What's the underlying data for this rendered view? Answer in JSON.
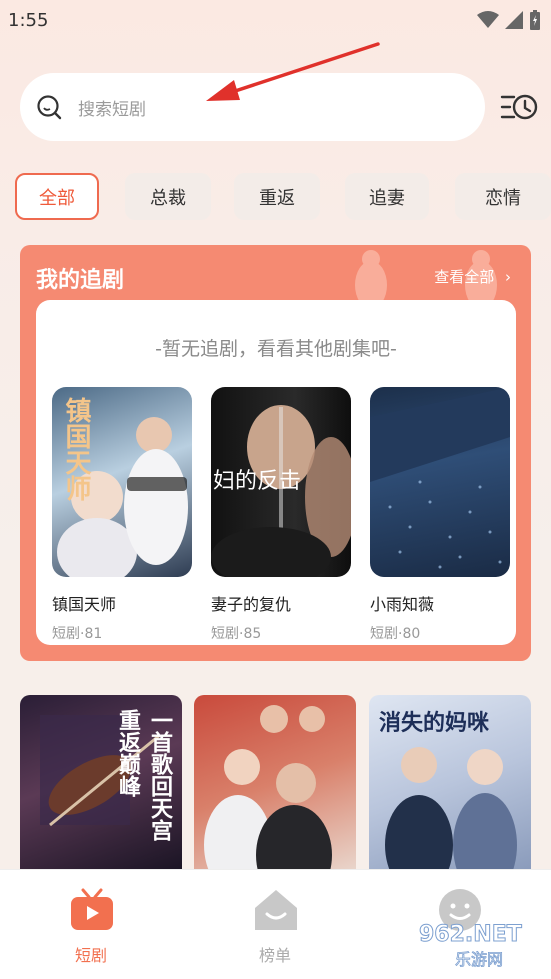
{
  "status": {
    "time": "1:55"
  },
  "search": {
    "placeholder": "搜索短剧"
  },
  "categories": [
    "全部",
    "总裁",
    "重返",
    "追妻",
    "恋情"
  ],
  "follow_section": {
    "title": "我的追剧",
    "more_label": "查看全部",
    "empty_text": "-暂无追剧，看看其他剧集吧-"
  },
  "dramas": [
    {
      "title": "镇国天师",
      "meta": "短剧·81",
      "cover_text": "镇国天师"
    },
    {
      "title": "妻子的复仇",
      "meta": "短剧·85",
      "cover_text": "妇的反击"
    },
    {
      "title": "小雨知薇",
      "meta": "短剧·80",
      "cover_text": ""
    }
  ],
  "grid": [
    {
      "cover_text": "一首歌回天宫 重返巅峰"
    },
    {
      "cover_text": ""
    },
    {
      "cover_text": "消失的妈咪"
    }
  ],
  "tabs": [
    {
      "label": "短剧",
      "icon": "tv-icon"
    },
    {
      "label": "榜单",
      "icon": "house-icon"
    },
    {
      "label": "",
      "icon": "smiley-icon"
    }
  ],
  "watermark": {
    "text": "962.NET 乐游网"
  },
  "colors": {
    "accent": "#ef5a3a",
    "card": "#f58a72",
    "tab_active": "#f2704f"
  }
}
